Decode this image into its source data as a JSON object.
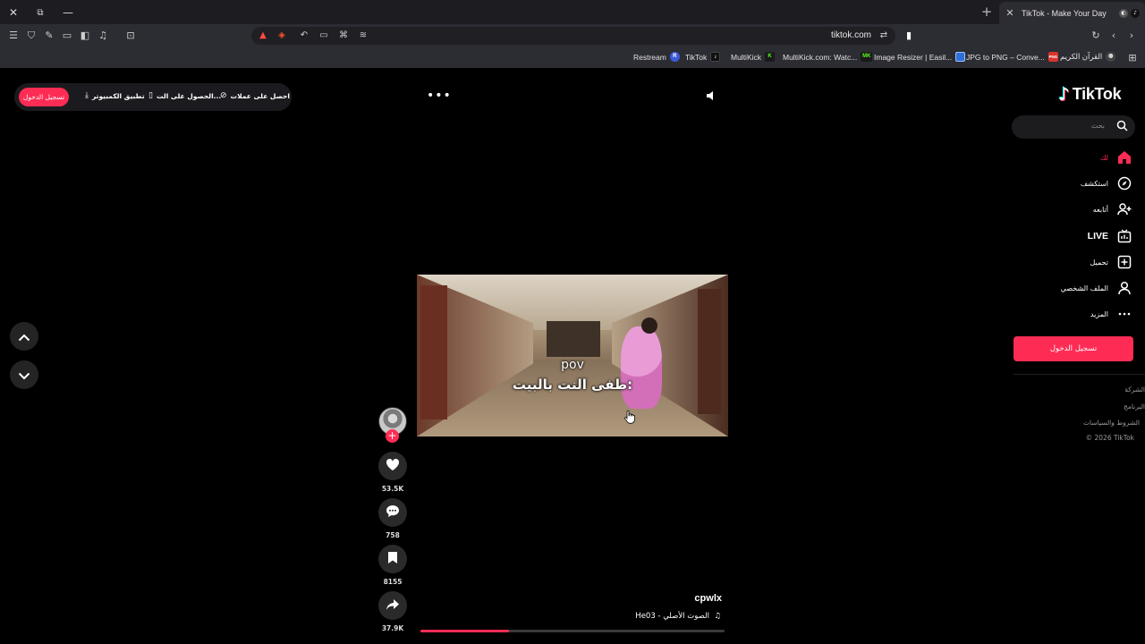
{
  "browser": {
    "tab": {
      "title": "TikTok - Make Your Day"
    },
    "address": {
      "url": "tiktok.com"
    },
    "bookmarks": [
      {
        "label": "Restream",
        "icon": "restream-icon",
        "badge": "R",
        "color": "#3b5bdb"
      },
      {
        "label": "TikTok",
        "icon": "tiktok-icon",
        "badge": "♪",
        "color": "#111111"
      },
      {
        "label": "MultiKick",
        "icon": "multikick-icon",
        "badge": "K",
        "color": "#53fc18"
      },
      {
        "label": "MultiKick.com: Watc...",
        "icon": "multikick-icon",
        "badge": "MK",
        "color": "#53fc18"
      },
      {
        "label": "Image Resizer | Easil...",
        "icon": "image-resizer-icon",
        "badge": "",
        "color": "#2f6fd6"
      },
      {
        "label": "JPG to PNG – Conve...",
        "icon": "converter-icon",
        "badge": "PNG",
        "color": "#d9342b"
      },
      {
        "label": "القرآن الكريم",
        "icon": "globe-icon",
        "badge": "◍",
        "color": "#444444"
      }
    ]
  },
  "header": {
    "login_button": "تسجيل الدخول",
    "desktop_app": "تطبيق الكمبيوتر",
    "get_app": "الحصول على الت...",
    "get_coins": "احصل على عملات"
  },
  "sidebar": {
    "logo": "TikTok",
    "search_placeholder": "بحث",
    "nav": [
      {
        "label": "لك",
        "icon": "home-icon",
        "active": true
      },
      {
        "label": "استكشف",
        "icon": "compass-icon",
        "active": false
      },
      {
        "label": "أتابعه",
        "icon": "following-icon",
        "active": false
      },
      {
        "label": "LIVE",
        "icon": "live-icon",
        "active": false
      },
      {
        "label": "تحميل",
        "icon": "upload-icon",
        "active": false
      },
      {
        "label": "الملف الشخصي",
        "icon": "profile-icon",
        "active": false
      },
      {
        "label": "المزيد",
        "icon": "more-icon",
        "active": false
      }
    ],
    "login_button": "تسجيل الدخول",
    "footer": [
      "الشركة",
      "البرنامج",
      "الشروط والسياسات",
      "© 2026 TikTok"
    ]
  },
  "video": {
    "caption_line1": "pov",
    "caption_line2": "طفى النت بالبيت:",
    "author": "cpwlx",
    "music": "He03 - الصوت الأصلي",
    "progress": 0.29
  },
  "actions": {
    "likes": "53.5K",
    "comments": "758",
    "bookmarks": "8155",
    "shares": "37.9K"
  },
  "colors": {
    "accent": "#fe2c55",
    "background": "#000000",
    "chrome": "#2c2c33"
  }
}
